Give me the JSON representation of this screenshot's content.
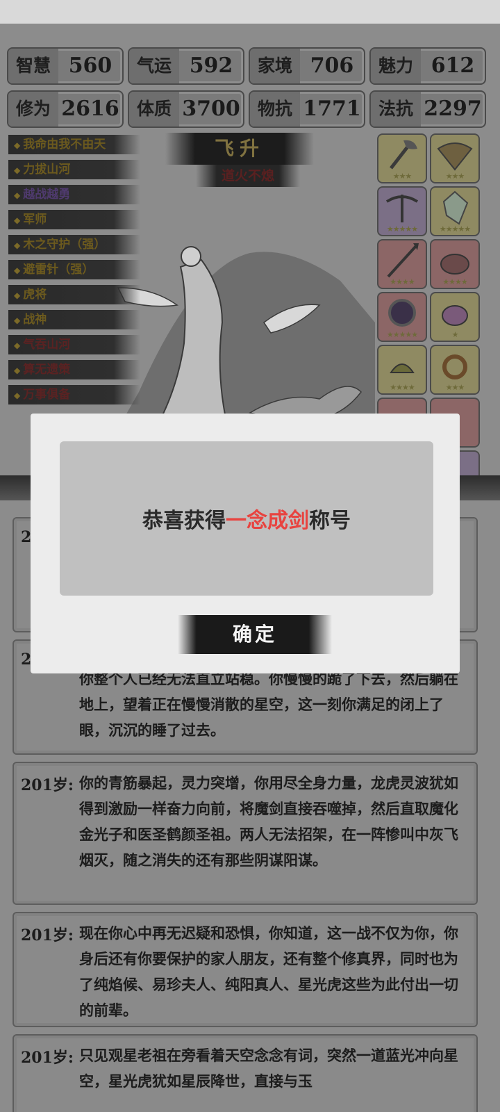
{
  "stats": [
    {
      "label": "智慧",
      "value": "560"
    },
    {
      "label": "气运",
      "value": "592"
    },
    {
      "label": "家境",
      "value": "706"
    },
    {
      "label": "魅力",
      "value": "612"
    },
    {
      "label": "修为",
      "value": "2616"
    },
    {
      "label": "体质",
      "value": "3700"
    },
    {
      "label": "物抗",
      "value": "1771"
    },
    {
      "label": "法抗",
      "value": "2297"
    }
  ],
  "skills": [
    "我命由我不由天",
    "力拔山河",
    "越战越勇",
    "军师",
    "木之守护（强）",
    "避雷针（强）",
    "虎将",
    "战神",
    "气吞山河",
    "算无遗策",
    "万事俱备"
  ],
  "stage": {
    "title": "飞升",
    "subtitle": "道火不熄"
  },
  "items": [
    {
      "icon": "axe-icon",
      "stars": "★★★"
    },
    {
      "icon": "fan-icon",
      "stars": "★★★"
    },
    {
      "icon": "crossbow-icon",
      "stars": "★★★★★"
    },
    {
      "icon": "crystal-icon",
      "stars": "★★★★★"
    },
    {
      "icon": "spear-icon",
      "stars": "★★★★"
    },
    {
      "icon": "cauldron-icon",
      "stars": "★★★★"
    },
    {
      "icon": "mirror-icon",
      "stars": "★★★★★"
    },
    {
      "icon": "teapot-icon",
      "stars": "★"
    },
    {
      "icon": "incense-burner-icon",
      "stars": "★★★★"
    },
    {
      "icon": "ring-icon",
      "stars": "★★★"
    }
  ],
  "log": [
    {
      "age": "20",
      "text": ""
    },
    {
      "age": "20",
      "text": "你整个人已经无法直立站稳。你慢慢的跪了下去，然后躺在地上，望着正在慢慢消散的星空，这一刻你满足的闭上了眼，沉沉的睡了过去。"
    },
    {
      "age": "201岁:",
      "text": "你的青筋暴起，灵力突增，你用尽全身力量，龙虎灵波犹如得到激励一样奋力向前，将魔剑直接吞噬掉，然后直取魔化金光子和医圣鹤颜圣祖。两人无法招架，在一阵惨叫中灰飞烟灭，随之消失的还有那些阴谋阳谋。"
    },
    {
      "age": "201岁:",
      "text": "现在你心中再无迟疑和恐惧，你知道，这一战不仅为你，你身后还有你要保护的家人朋友，还有整个修真界，同时也为了纯焰候、易珍夫人、纯阳真人、星光虎这些为此付出一切的前辈。"
    },
    {
      "age": "201岁:",
      "text": "只见观星老祖在旁看着天空念念有词，突然一道蓝光冲向星空，星光虎犹如星辰降世，直接与玉"
    }
  ],
  "modal": {
    "prefix": "恭喜获得",
    "highlight": "一念成剑",
    "suffix": "称号",
    "confirm": "确定",
    "highlight_color": "#e8433f"
  }
}
